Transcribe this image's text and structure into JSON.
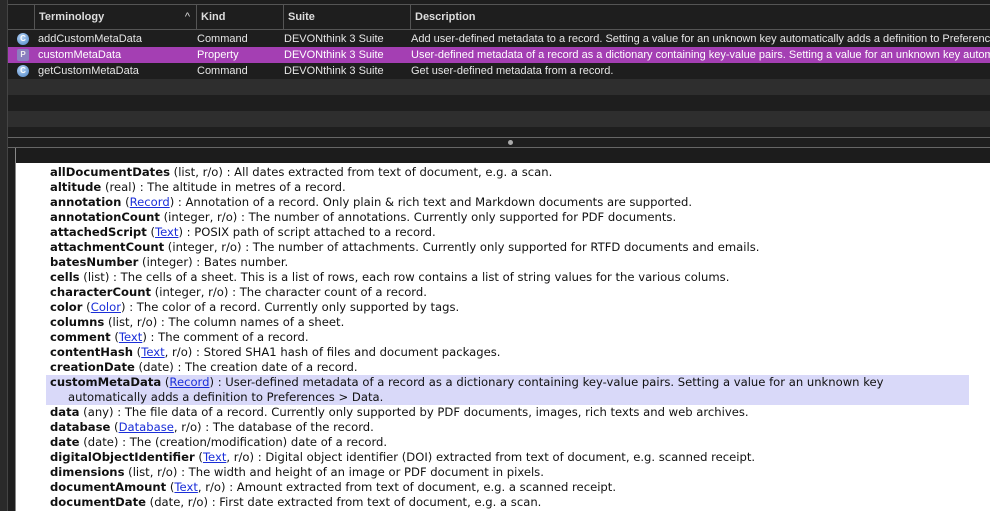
{
  "table": {
    "columns": [
      "Terminology",
      "Kind",
      "Suite",
      "Description"
    ],
    "rows": [
      {
        "icon": "C",
        "name": "addCustomMetaData",
        "kind": "Command",
        "suite": "DEVONthink 3 Suite",
        "desc": "Add user-defined metadata to a record. Setting a value for an unknown key automatically adds a definition to Preferences > Data."
      },
      {
        "icon": "P",
        "name": "customMetaData",
        "kind": "Property",
        "suite": "DEVONthink 3 Suite",
        "desc": "User-defined metadata of a record as a dictionary containing key-value pairs. Setting a value for an unknown key automatically adds a definition to Preferences > Data.",
        "selected": true
      },
      {
        "icon": "C",
        "name": "getCustomMetaData",
        "kind": "Command",
        "suite": "DEVONthink 3 Suite",
        "desc": "Get user-defined metadata from a record."
      }
    ]
  },
  "doc": {
    "lines": [
      {
        "name": "allDocumentDates",
        "pre": " (",
        "type": "list, r/o",
        "link": "",
        "post": ") : All dates extracted from text of document, e.g. a scan."
      },
      {
        "name": "altitude",
        "pre": " (",
        "type": "real",
        "link": "",
        "post": ") : The altitude in metres of a record."
      },
      {
        "name": "annotation",
        "pre": " (",
        "type": "",
        "link": "Record",
        "post": ") : Annotation of a record. Only plain & rich text and Markdown documents are supported."
      },
      {
        "name": "annotationCount",
        "pre": " (",
        "type": "integer, r/o",
        "link": "",
        "post": ") : The number of annotations. Currently only supported for PDF documents."
      },
      {
        "name": "attachedScript",
        "pre": " (",
        "type": "",
        "link": "Text",
        "post": ") : POSIX path of script attached to a record."
      },
      {
        "name": "attachmentCount",
        "pre": " (",
        "type": "integer, r/o",
        "link": "",
        "post": ") : The number of attachments. Currently only supported for RTFD documents and emails."
      },
      {
        "name": "batesNumber",
        "pre": " (",
        "type": "integer",
        "link": "",
        "post": ") : Bates number."
      },
      {
        "name": "cells",
        "pre": " (",
        "type": "list",
        "link": "",
        "post": ") : The cells of a sheet. This is a list of rows, each row contains a list of string values for the various colums."
      },
      {
        "name": "characterCount",
        "pre": " (",
        "type": "integer, r/o",
        "link": "",
        "post": ") : The character count of a record."
      },
      {
        "name": "color",
        "pre": " (",
        "type": "",
        "link": "Color",
        "post": ") : The color of a record. Currently only supported by tags."
      },
      {
        "name": "columns",
        "pre": " (",
        "type": "list, r/o",
        "link": "",
        "post": ") : The column names of a sheet."
      },
      {
        "name": "comment",
        "pre": " (",
        "type": "",
        "link": "Text",
        "post": ") : The comment of a record."
      },
      {
        "name": "contentHash",
        "pre": " (",
        "type": "",
        "link": "Text",
        "post": ", r/o) : Stored SHA1 hash of files and document packages."
      },
      {
        "name": "creationDate",
        "pre": " (",
        "type": "date",
        "link": "",
        "post": ") : The creation date of a record."
      },
      {
        "name": "customMetaData",
        "pre": " (",
        "type": "",
        "link": "Record",
        "post": ") : User-defined metadata of a record as a dictionary containing key-value pairs. Setting a value for an unknown key",
        "cont": "automatically adds a definition to Preferences > Data.",
        "highlight": true
      },
      {
        "name": "data",
        "pre": " (",
        "type": "any",
        "link": "",
        "post": ") : The file data of a record. Currently only supported by PDF documents, images, rich texts and web archives."
      },
      {
        "name": "database",
        "pre": " (",
        "type": "",
        "link": "Database",
        "post": ", r/o) : The database of the record."
      },
      {
        "name": "date",
        "pre": " (",
        "type": "date",
        "link": "",
        "post": ") : The (creation/modification) date of a record."
      },
      {
        "name": "digitalObjectIdentifier",
        "pre": " (",
        "type": "",
        "link": "Text",
        "post": ", r/o) : Digital object identifier (DOI) extracted from text of document, e.g. scanned receipt."
      },
      {
        "name": "dimensions",
        "pre": " (",
        "type": "list, r/o",
        "link": "",
        "post": ") : The width and height of an image or PDF document in pixels."
      },
      {
        "name": "documentAmount",
        "pre": " (",
        "type": "",
        "link": "Text",
        "post": ", r/o) : Amount extracted from text of document, e.g. a scanned receipt."
      },
      {
        "name": "documentDate",
        "pre": " (",
        "type": "date, r/o",
        "link": "",
        "post": ") : First date extracted from text of document, e.g. a scan."
      }
    ]
  }
}
